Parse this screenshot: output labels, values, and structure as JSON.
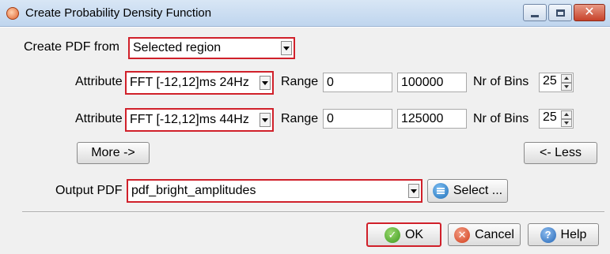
{
  "window": {
    "title": "Create Probability Density Function",
    "controls": [
      "minimize",
      "maximize",
      "close"
    ]
  },
  "create_from": {
    "label": "Create PDF from",
    "value": "Selected region"
  },
  "attributes": [
    {
      "label": "Attribute",
      "value": "FFT [-12,12]ms 24Hz",
      "range_label": "Range",
      "range_min": "0",
      "range_max": "100000",
      "bins_label": "Nr of Bins",
      "bins": "25"
    },
    {
      "label": "Attribute",
      "value": "FFT [-12,12]ms 44Hz",
      "range_label": "Range",
      "range_min": "0",
      "range_max": "125000",
      "bins_label": "Nr of Bins",
      "bins": "25"
    }
  ],
  "more_button": "More ->",
  "less_button": "<- Less",
  "output": {
    "label": "Output PDF",
    "value": "pdf_bright_amplitudes",
    "select_button": "Select ..."
  },
  "footer": {
    "ok": "OK",
    "cancel": "Cancel",
    "help": "Help"
  },
  "colors": {
    "highlight": "#d0202a",
    "dialog_bg": "#f0f0f0",
    "titlebar": "#c8dbf0"
  },
  "icons": {
    "title": "app-icon",
    "select": "list-icon",
    "ok": "check-icon",
    "cancel": "close-circle-icon",
    "help": "question-icon"
  }
}
